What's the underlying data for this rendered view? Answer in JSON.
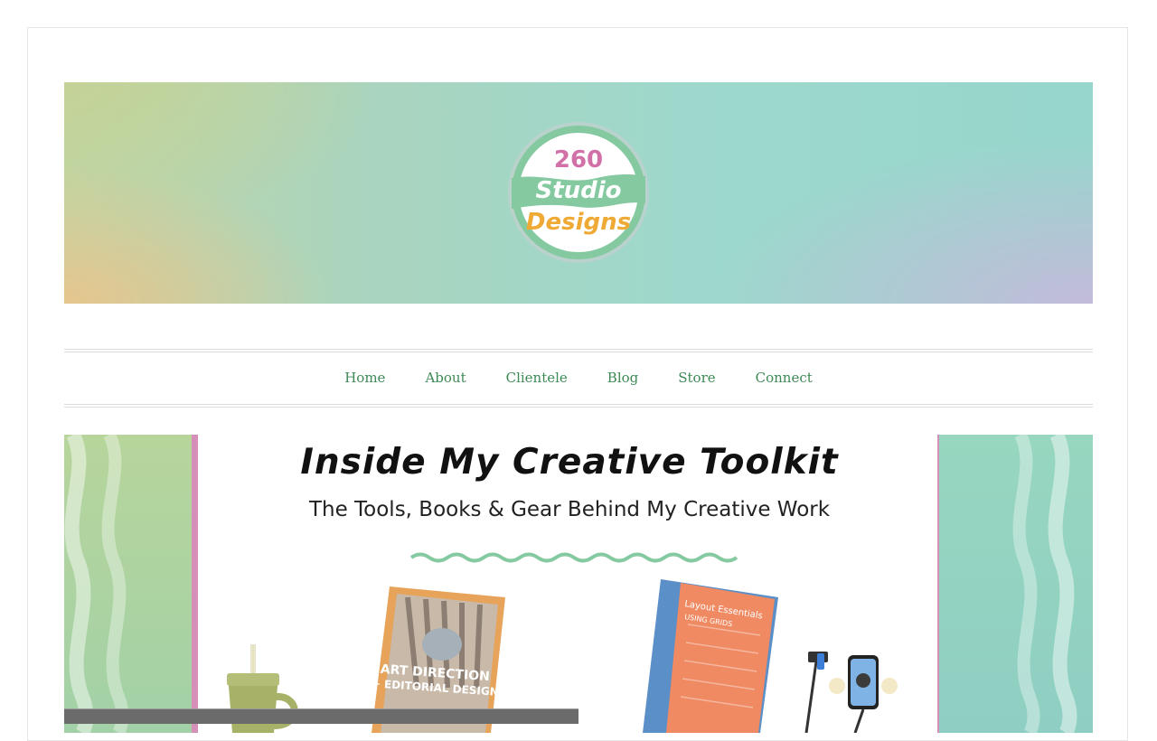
{
  "site": {
    "logo_line1": "260",
    "logo_line2": "Studio",
    "logo_line3": "Designs"
  },
  "nav": {
    "items": [
      {
        "label": "Home"
      },
      {
        "label": "About"
      },
      {
        "label": "Clientele"
      },
      {
        "label": "Blog"
      },
      {
        "label": "Store"
      },
      {
        "label": "Connect"
      }
    ]
  },
  "hero": {
    "title": "Inside My Creative Toolkit",
    "subtitle": "The Tools, Books & Gear Behind My Creative Work",
    "book1_line1": "ART DIRECTION",
    "book1_line2": "+ EDITORIAL DESIGN",
    "book2_line1": "Layout Essentials",
    "book2_line2": "USING GRIDS"
  },
  "colors": {
    "nav_link": "#3d8a55",
    "logo_ring": "#84c9a0",
    "logo_pink": "#d270a8",
    "logo_orange": "#eeaa35",
    "accent_pink": "#d58fb9"
  }
}
